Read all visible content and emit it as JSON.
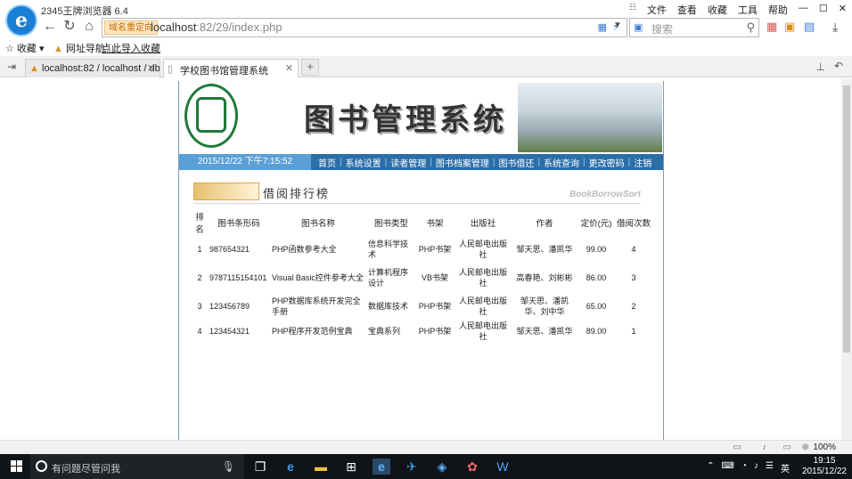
{
  "browser": {
    "title": "2345王牌浏览器 6.4",
    "menu": [
      "文件",
      "查看",
      "收藏",
      "工具",
      "帮助"
    ],
    "address_tag": "域名重定向",
    "address_host": "localhost",
    "address_rest": ":82/29/index.php",
    "search_placeholder": "搜索",
    "bookmarks": {
      "fav": "收藏",
      "nav": "网址导航",
      "import": "点此导入收藏"
    },
    "tabs": [
      {
        "label": "localhost:82 / localhost / db"
      },
      {
        "label": "学校图书馆管理系统"
      }
    ],
    "zoom": "100%"
  },
  "site": {
    "banner_title": "图书管理系统",
    "datetime": "2015/12/22 下午7:15:52",
    "nav": [
      "首页",
      "系统设置",
      "读者管理",
      "图书档案管理",
      "图书借还",
      "系统查询",
      "更改密码",
      "注销"
    ],
    "section_title": "借阅排行榜",
    "section_en": "BookBorrowSort",
    "columns": [
      "排名",
      "图书条形码",
      "图书名称",
      "图书类型",
      "书架",
      "出版社",
      "作者",
      "定价(元)",
      "借阅次数"
    ],
    "rows": [
      [
        "1",
        "987654321",
        "PHP函数参考大全",
        "信息科学技术",
        "PHP书架",
        "人民邮电出版社",
        "邹天思、潘凯华",
        "99.00",
        "4"
      ],
      [
        "2",
        "9787115154101",
        "Visual Basic控件参考大全",
        "计算机程序设计",
        "VB书架",
        "人民邮电出版社",
        "高春艳、刘彬彬",
        "86.00",
        "3"
      ],
      [
        "3",
        "123456789",
        "PHP数据库系统开发完全手册",
        "数据库技术",
        "PHP书架",
        "人民邮电出版社",
        "邹天思、潘凯华、刘中华",
        "65.00",
        "2"
      ],
      [
        "4",
        "123454321",
        "PHP程序开发范例宝典",
        "宝典系列",
        "PHP书架",
        "人民邮电出版社",
        "邹天思、潘凯华",
        "89.00",
        "1"
      ]
    ]
  },
  "taskbar": {
    "search_placeholder": "有问题尽管问我",
    "ime": "英",
    "time": "19:15",
    "date": "2015/12/22"
  }
}
